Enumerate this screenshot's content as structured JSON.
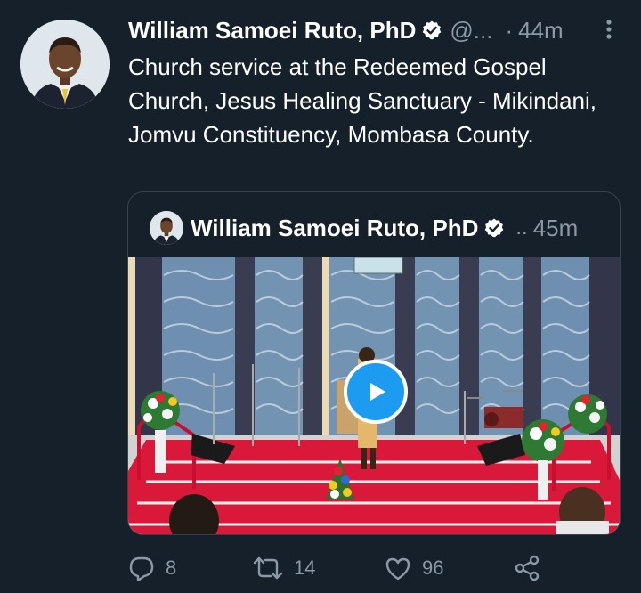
{
  "tweet": {
    "author_name": "William Samoei Ruto, PhD",
    "handle": "@...",
    "separator": "·",
    "time": "44m",
    "text": "Church service at the Redeemed Gospel Church, Jesus Healing Sanctuary - Mikindani, Jomvu Constituency, Mombasa County.",
    "avatar_icon": "avatar",
    "verified_icon": "verified-badge-icon",
    "more_icon": "more-vertical-icon"
  },
  "quoted_tweet": {
    "author_name": "William Samoei Ruto, PhD",
    "ellipsis": "..",
    "time": "45m",
    "media_type": "video",
    "play_icon": "play-icon"
  },
  "actions": {
    "reply_count": "8",
    "retweet_count": "14",
    "like_count": "96",
    "reply_icon": "comment-icon",
    "retweet_icon": "retweet-icon",
    "like_icon": "heart-icon",
    "share_icon": "share-icon"
  },
  "colors": {
    "background": "#15202b",
    "secondary_text": "#8b98a5",
    "border": "#38444d",
    "accent": "#1d9bf0"
  }
}
